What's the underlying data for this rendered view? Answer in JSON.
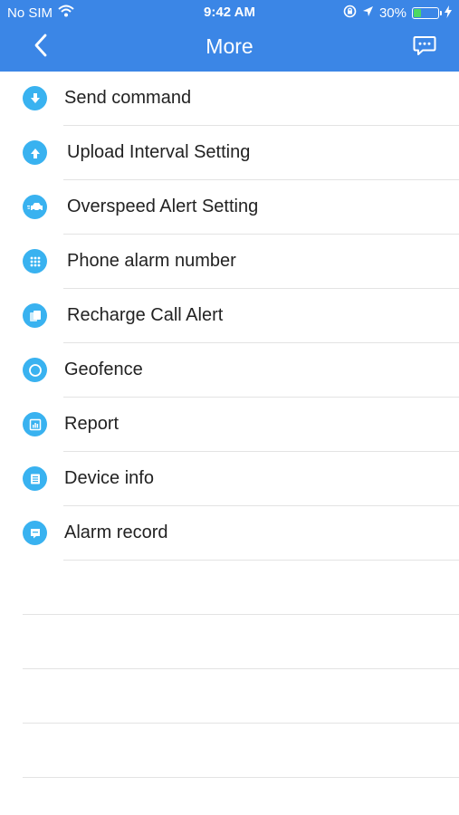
{
  "status_bar": {
    "carrier": "No SIM",
    "time": "9:42 AM",
    "battery_percent": "30%",
    "battery_level": 0.3,
    "icons": [
      "wifi-icon",
      "orientation-lock-icon",
      "location-arrow-icon",
      "battery-icon",
      "charging-bolt-icon"
    ]
  },
  "navbar": {
    "title": "More",
    "back_icon": "chevron-left-icon",
    "right_icon": "message-icon"
  },
  "menu": {
    "items": [
      {
        "label": "Send command",
        "icon": "download-arrow-icon"
      },
      {
        "label": "Upload Interval Setting",
        "icon": "upload-arrow-icon"
      },
      {
        "label": "Overspeed Alert Setting",
        "icon": "speeding-car-icon"
      },
      {
        "label": "Phone alarm number",
        "icon": "dialpad-icon"
      },
      {
        "label": "Recharge Call Alert",
        "icon": "recharge-card-icon"
      },
      {
        "label": "Geofence",
        "icon": "geofence-circle-icon"
      },
      {
        "label": "Report",
        "icon": "report-chart-icon"
      },
      {
        "label": "Device info",
        "icon": "device-info-icon"
      },
      {
        "label": "Alarm record",
        "icon": "alarm-record-icon"
      }
    ]
  },
  "colors": {
    "header": "#3b86e6",
    "icon_bg": "#39b2f0",
    "battery_fill": "#4cd964",
    "separator": "#e3e3e3"
  }
}
